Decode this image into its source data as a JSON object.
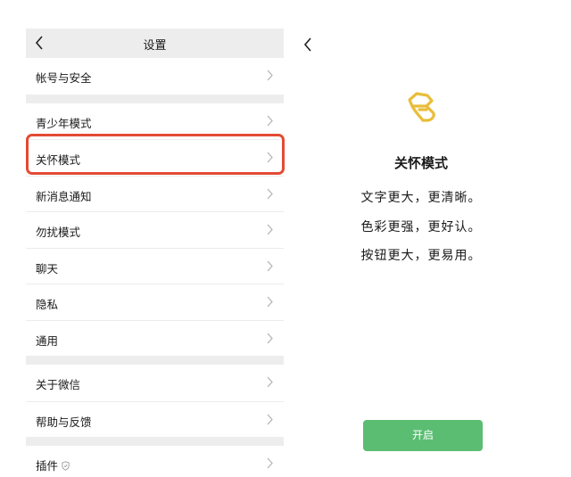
{
  "settings": {
    "title": "设置",
    "groups": [
      {
        "items": [
          {
            "label": "帐号与安全"
          }
        ]
      },
      {
        "items": [
          {
            "label": "青少年模式"
          },
          {
            "label": "关怀模式"
          },
          {
            "label": "新消息通知"
          },
          {
            "label": "勿扰模式"
          },
          {
            "label": "聊天"
          },
          {
            "label": "隐私"
          },
          {
            "label": "通用"
          }
        ]
      },
      {
        "items": [
          {
            "label": "关于微信"
          },
          {
            "label": "帮助与反馈"
          }
        ]
      },
      {
        "items": [
          {
            "label": "插件"
          }
        ]
      }
    ],
    "highlighted_item": "关怀模式",
    "highlight_color": "#e34b34"
  },
  "care_mode": {
    "title": "关怀模式",
    "icon": "care-hand-heart-icon",
    "icon_color": "#e9bd3b",
    "lines": [
      "文字更大，更清晰。",
      "色彩更强，更好认。",
      "按钮更大，更易用。"
    ],
    "button_label": "开启",
    "button_color": "#5bbd72"
  }
}
